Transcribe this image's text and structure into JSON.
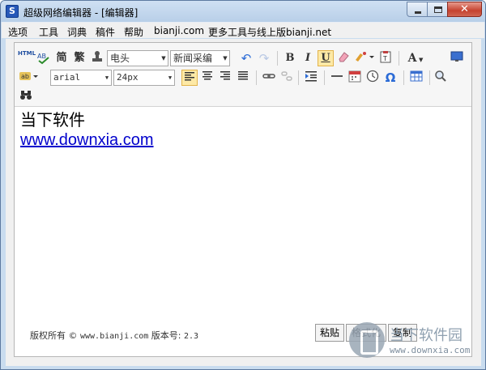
{
  "window": {
    "title": "超级网络编辑器 - [编辑器]",
    "app_icon_letter": "S"
  },
  "menu": {
    "items": [
      "选项",
      "工具",
      "词典",
      "稿件",
      "帮助",
      "bianji.com",
      "更多工具与线上版bianji.net"
    ]
  },
  "toolbar": {
    "row1": {
      "html_label": "HTML",
      "jian_label": "简",
      "fan_label": "繁",
      "style_select": "电头",
      "template_select": "新闻采编",
      "bold": "B",
      "italic": "I",
      "underline": "U",
      "font_color": "A",
      "omega": "Ω"
    },
    "row2": {
      "font_family": "arial",
      "font_size": "24px"
    }
  },
  "document": {
    "line1": "当下软件",
    "link_text": "www.downxia.com"
  },
  "footer": {
    "copyright": "版权所有 ©",
    "site": "www.bianji.com",
    "version_label": "版本号:",
    "version": "2.3",
    "buttons": [
      "粘贴",
      "格式化",
      "复制"
    ]
  },
  "watermark": {
    "title": "当下软件园",
    "url": "www.downxia.com"
  },
  "colors": {
    "link": "#0000cc",
    "title_bar": "#c9dcef",
    "active_button": "#fde9a6"
  }
}
